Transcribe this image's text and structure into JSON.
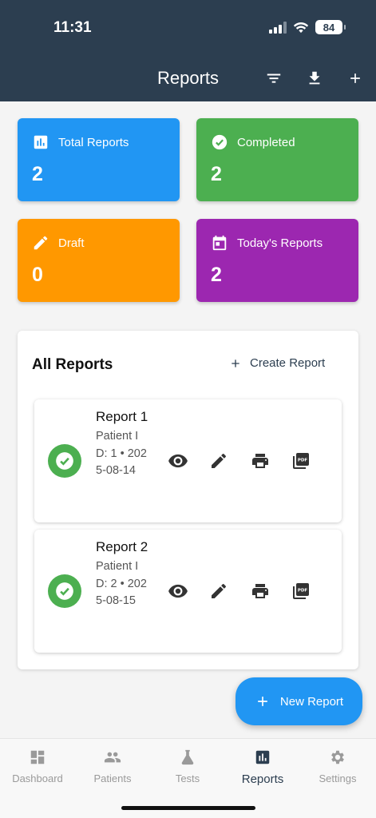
{
  "status_bar": {
    "time": "11:31",
    "battery": "84"
  },
  "header": {
    "title": "Reports"
  },
  "stats": [
    {
      "label": "Total Reports",
      "value": "2",
      "color": "#2196f3",
      "icon": "bar-chart-icon"
    },
    {
      "label": "Completed",
      "value": "2",
      "color": "#4caf50",
      "icon": "check-circle-icon"
    },
    {
      "label": "Draft",
      "value": "0",
      "color": "#ff9800",
      "icon": "pencil-icon"
    },
    {
      "label": "Today's Reports",
      "value": "2",
      "color": "#9c27b0",
      "icon": "calendar-icon"
    }
  ],
  "panel": {
    "title": "All Reports",
    "create_label": "Create Report"
  },
  "reports": [
    {
      "name": "Report 1",
      "meta": "Patient ID: 1 • 2025-08-14",
      "status": "completed"
    },
    {
      "name": "Report 2",
      "meta": "Patient ID: 2 • 2025-08-15",
      "status": "completed"
    }
  ],
  "fab": {
    "label": "New Report"
  },
  "nav": [
    {
      "label": "Dashboard",
      "icon": "dashboard-icon"
    },
    {
      "label": "Patients",
      "icon": "people-icon"
    },
    {
      "label": "Tests",
      "icon": "flask-icon"
    },
    {
      "label": "Reports",
      "icon": "bar-chart-icon"
    },
    {
      "label": "Settings",
      "icon": "gear-icon"
    }
  ],
  "colors": {
    "header": "#2c3e50",
    "accent": "#2196f3",
    "success": "#4caf50"
  }
}
